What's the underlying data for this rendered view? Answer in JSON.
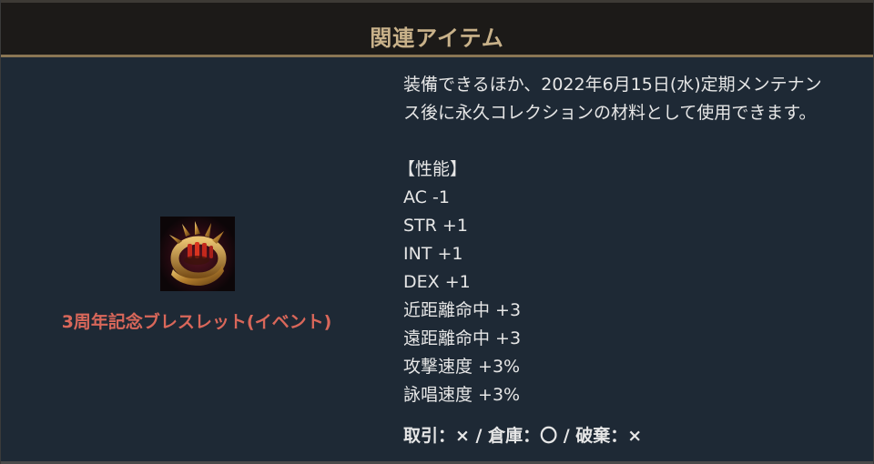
{
  "header": {
    "title": "関連アイテム"
  },
  "item": {
    "icon": "bracelet-icon",
    "name": "3周年記念ブレスレット(イベント)",
    "name_color": "#d9675a"
  },
  "description": {
    "line1": "装備できるほか、2022年6月15日(水)定期メンテナン",
    "line2": "ス後に永久コレクションの材料として使用できます。"
  },
  "stats": {
    "heading": "【性能】",
    "items": [
      "AC -1",
      "STR +1",
      "INT +1",
      "DEX +1",
      "近距離命中 +3",
      "遠距離命中 +3",
      "攻撃速度 +3%",
      "詠唱速度 +3%"
    ]
  },
  "trade": {
    "text": "取引：× / 倉庫：〇 / 破棄：×"
  },
  "colors": {
    "background": "#1e2935",
    "header_bg": "#1c1a18",
    "header_title": "#c9b28a",
    "accent_line": "#8a7654"
  }
}
